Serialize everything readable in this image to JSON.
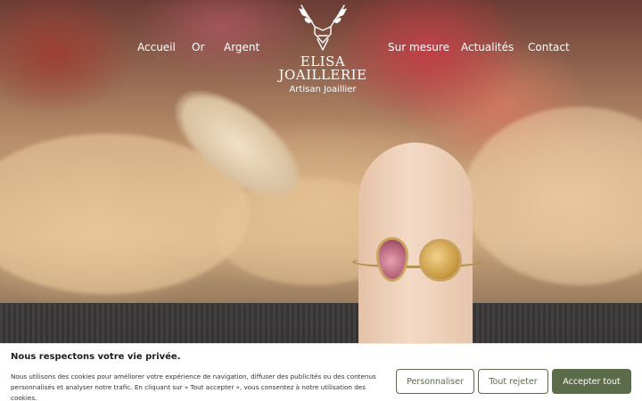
{
  "nav": {
    "left": [
      "Accueil",
      "Or",
      "Argent"
    ],
    "right": [
      "Sur mesure",
      "Actualités",
      "Contact"
    ]
  },
  "logo": {
    "line1": "ELISA",
    "line2": "JOAILLERIE",
    "tagline": "Artisan Joaillier"
  },
  "cookie": {
    "title": "Nous respectons votre vie privée.",
    "text": "Nous utilisons des cookies pour améliorer votre expérience de navigation, diffuser des publicités ou des contenus personnalisés et analyser notre trafic. En cliquant sur « Tout accepter », vous consentez à notre utilisation des cookies.",
    "customize_label": "Personnaliser",
    "reject_label": "Tout rejeter",
    "accept_label": "Accepter tout"
  },
  "colors": {
    "accent": "#5c6b4a",
    "nav_text": "#ffffff"
  },
  "icons": {
    "logo_emblem": "deer-antler-emblem-icon"
  }
}
